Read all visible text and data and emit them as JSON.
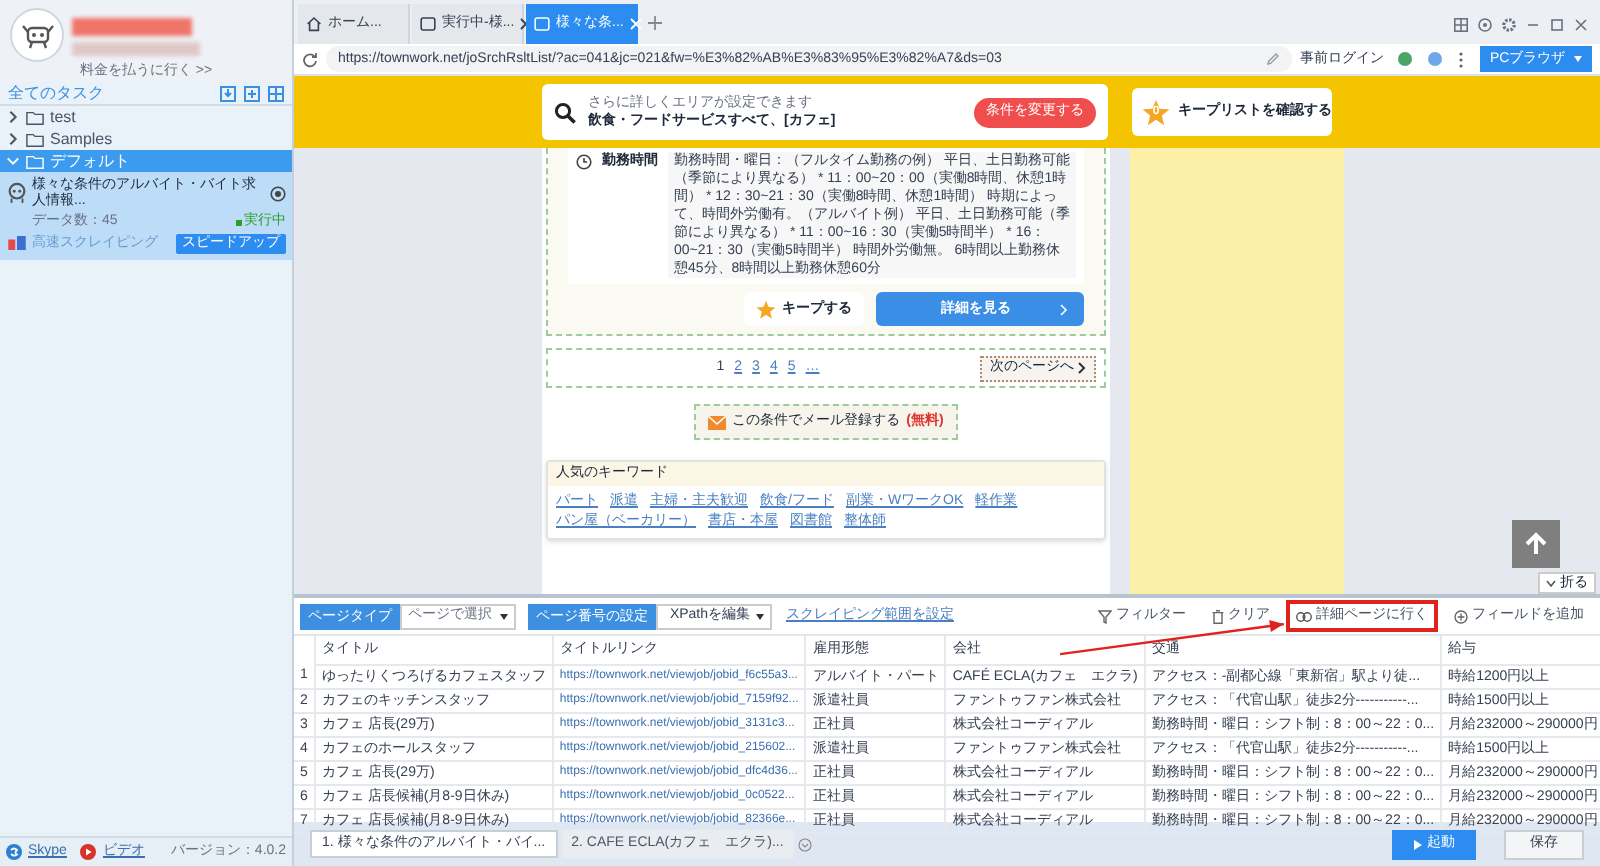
{
  "sidebar": {
    "billing_link": "料金を払うに行く >>",
    "tasks_header": "全てのタスク",
    "folders": [
      {
        "name": "test",
        "expanded": false,
        "selected": false
      },
      {
        "name": "Samples",
        "expanded": false,
        "selected": false
      },
      {
        "name": "デフォルト",
        "expanded": true,
        "selected": true,
        "tasks": [
          {
            "title": "様々な条件のアルバイト・バイト求人情報...",
            "count_label": "データ数：45",
            "status": "実行中",
            "mode": "高速スクレイピング",
            "boost_button": "スピードアップ"
          }
        ]
      }
    ],
    "footer_links": [
      {
        "label": "Skype",
        "kind": "skype"
      },
      {
        "label": "ビデオ",
        "kind": "video"
      }
    ],
    "version": "バージョン：4.0.2"
  },
  "browser": {
    "tabs": [
      {
        "label": "ホーム...",
        "kind": "home",
        "selected": false,
        "closable": false
      },
      {
        "label": "実行中-様...",
        "kind": "page",
        "selected": false,
        "closable": true
      },
      {
        "label": "様々な条...",
        "kind": "page",
        "selected": true,
        "closable": true
      }
    ],
    "url": "https://townwork.net/joSrchRsltList/?ac=041&jc=021&fw=%E3%82%AB%E3%83%95%E3%82%A7&ds=03",
    "pre_login": "事前ログイン",
    "mode_button": "PCブラウザ"
  },
  "page": {
    "search_hint": "さらに詳しくエリアが設定できます",
    "search_condition": "飲食・フードサービスすべて、[カフェ]",
    "change_button": "条件を変更する",
    "keep_count": "0",
    "keep_list_button": "キープリストを確認する",
    "detail_label": "勤務時間",
    "detail_text": "勤務時間・曜日：（フルタイム勤務の例） 平日、土日勤務可能（季節により異なる） * 11：00~20：00（実働8時間、休憩1時間） * 12：30~21：30（実働8時間、休憩1時間） 時期によって、時間外労働有。（アルバイト例） 平日、土日勤務可能（季節により異なる） * 11：00~16：30（実働5時間半） * 16：00~21：30（実働5時間半） 時間外労働無。 6時間以上勤務休憩45分、8時間以上勤務休憩60分",
    "keep_button": "キープする",
    "details_button": "詳細を見る",
    "pages": [
      {
        "label": "1",
        "selected": true
      },
      {
        "label": "2",
        "selected": false
      },
      {
        "label": "3",
        "selected": false
      },
      {
        "label": "4",
        "selected": false
      },
      {
        "label": "5",
        "selected": false
      },
      {
        "label": "…",
        "selected": false
      }
    ],
    "next_button": "次のページへ",
    "mail_button": "この条件でメール登録する",
    "mail_badge": "(無料)",
    "keywords_title": "人気のキーワード",
    "keywords": [
      "パート",
      "派遣",
      "主婦・主夫歓迎",
      "飲食/フード",
      "副業・WワークOK",
      "軽作業",
      "パン屋（ベーカリー）",
      "書店・本屋",
      "図書館",
      "整体師"
    ],
    "collapse_button": "折る"
  },
  "extraction": {
    "page_type_label": "ページタイプ",
    "page_type_value": "ページで選択",
    "paging_label": "ページ番号の設定",
    "paging_value": "XPathを編集",
    "range_link": "スクレイピング範囲を設定",
    "tools": [
      {
        "label": "フィルター",
        "kind": "filter",
        "highlighted": false
      },
      {
        "label": "クリア",
        "kind": "clear",
        "highlighted": false
      },
      {
        "label": "詳細ページに行く",
        "kind": "link",
        "highlighted": true
      },
      {
        "label": "フィールドを追加",
        "kind": "add",
        "highlighted": false
      }
    ],
    "columns": [
      "タイトル",
      "タイトルリンク",
      "雇用形態",
      "会社",
      "交通",
      "給与"
    ],
    "rows": [
      {
        "no": "1",
        "cells": [
          "ゆったりくつろげるカフェスタッフ",
          "https://townwork.net/viewjob/jobid_f6c55a3...",
          "アルバイト・パート",
          "CAFÉ ECLA(カフェ　エクラ)",
          "アクセス：-副都心線「東新宿」駅より徒...",
          "時給1200円以上"
        ]
      },
      {
        "no": "2",
        "cells": [
          "カフェのキッチンスタッフ",
          "https://townwork.net/viewjob/jobid_7159f92...",
          "派遣社員",
          "ファントゥファン株式会社",
          "アクセス：「代官山駅」徒歩2分-----------...",
          "時給1500円以上"
        ]
      },
      {
        "no": "3",
        "cells": [
          "カフェ 店長(29万)",
          "https://townwork.net/viewjob/jobid_3131c3...",
          "正社員",
          "株式会社コーディアル",
          "勤務時間・曜日：シフト制：8：00～22：0...",
          "月給232000～290000円"
        ]
      },
      {
        "no": "4",
        "cells": [
          "カフェのホールスタッフ",
          "https://townwork.net/viewjob/jobid_215602...",
          "派遣社員",
          "ファントゥファン株式会社",
          "アクセス：「代官山駅」徒歩2分-----------...",
          "時給1500円以上"
        ]
      },
      {
        "no": "5",
        "cells": [
          "カフェ 店長(29万)",
          "https://townwork.net/viewjob/jobid_dfc4d36...",
          "正社員",
          "株式会社コーディアル",
          "勤務時間・曜日：シフト制：8：00～22：0...",
          "月給232000～290000円"
        ]
      },
      {
        "no": "6",
        "cells": [
          "カフェ 店長候補(月8-9日休み)",
          "https://townwork.net/viewjob/jobid_0c0522...",
          "正社員",
          "株式会社コーディアル",
          "勤務時間・曜日：シフト制：8：00～22：0...",
          "月給232000～290000円"
        ]
      },
      {
        "no": "7",
        "cells": [
          "カフェ 店長候補(月8-9日休み)",
          "https://townwork.net/viewjob/jobid_82366e...",
          "正社員",
          "株式会社コーディアル",
          "勤務時間・曜日：シフト制：8：00～22：0...",
          "月給232000～290000円"
        ]
      }
    ],
    "result_tabs": [
      {
        "label": "1. 様々な条件のアルバイト・バイ...",
        "selected": true
      },
      {
        "label": "2. CAFE ECLA(カフェ　エクラ)...",
        "selected": false
      }
    ],
    "start_button": "起動",
    "save_button": "保存"
  }
}
